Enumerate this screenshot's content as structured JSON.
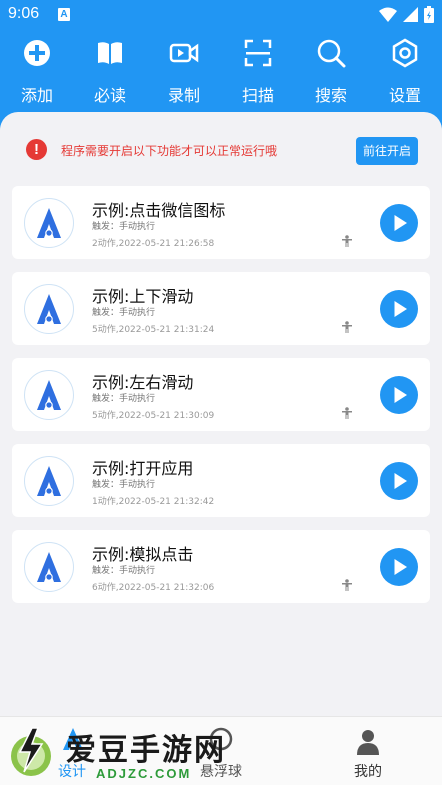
{
  "status_bar": {
    "time": "9:06",
    "notification_letter": "A"
  },
  "toolbar": {
    "items": [
      {
        "label": "添加",
        "icon": "plus-circle-icon"
      },
      {
        "label": "必读",
        "icon": "book-icon"
      },
      {
        "label": "录制",
        "icon": "video-camera-icon"
      },
      {
        "label": "扫描",
        "icon": "scan-icon"
      },
      {
        "label": "搜索",
        "icon": "search-icon"
      },
      {
        "label": "设置",
        "icon": "settings-hexagon-icon"
      }
    ]
  },
  "warning": {
    "icon_text": "!",
    "text": "程序需要开启以下功能才可以正常运行哦",
    "button_label": "前往开启"
  },
  "scripts": [
    {
      "title": "示例:点击微信图标",
      "trigger": "触发：手动执行",
      "meta": "2动作,2022-05-21 21:26:58",
      "show_person": true
    },
    {
      "title": "示例:上下滑动",
      "trigger": "触发：手动执行",
      "meta": "5动作,2022-05-21 21:31:24",
      "show_person": true
    },
    {
      "title": "示例:左右滑动",
      "trigger": "触发：手动执行",
      "meta": "5动作,2022-05-21 21:30:09",
      "show_person": true
    },
    {
      "title": "示例:打开应用",
      "trigger": "触发：手动执行",
      "meta": "1动作,2022-05-21 21:32:42",
      "show_person": false
    },
    {
      "title": "示例:模拟点击",
      "trigger": "触发：手动执行",
      "meta": "6动作,2022-05-21 21:32:06",
      "show_person": true
    }
  ],
  "bottom_nav": {
    "design": {
      "label": "设计",
      "icon": "design-a-icon",
      "active": true
    },
    "float": {
      "label": "悬浮球",
      "icon": "float-ball-icon"
    },
    "mine": {
      "label": "我的",
      "icon": "person-icon"
    }
  },
  "watermark": {
    "title": "爱豆手游网",
    "url": "ADJZC.COM"
  },
  "colors": {
    "primary": "#2196f3",
    "warning": "#e53935",
    "background": "#f2f2f5",
    "watermark_green": "#2e9b3a"
  }
}
